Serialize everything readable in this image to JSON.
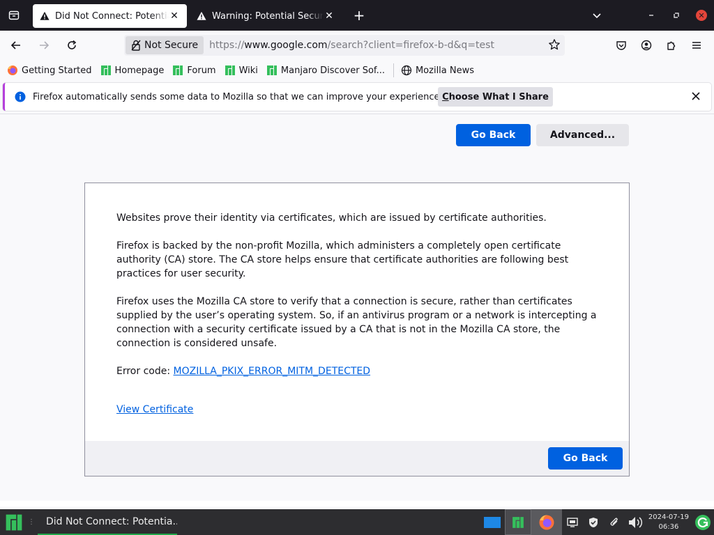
{
  "tabs": [
    {
      "title": "Did Not Connect: Potential Security Issue",
      "active": true
    },
    {
      "title": "Warning: Potential Security Risk Ahead",
      "active": false
    }
  ],
  "navbar": {
    "not_secure_label": "Not Secure",
    "url_scheme": "https://",
    "url_host": "www.google.com",
    "url_path": "/search?client=firefox-b-d&q=test"
  },
  "bookmarks": [
    {
      "label": "Getting Started",
      "icon": "firefox-icon"
    },
    {
      "label": "Homepage",
      "icon": "manjaro-icon"
    },
    {
      "label": "Forum",
      "icon": "manjaro-icon"
    },
    {
      "label": "Wiki",
      "icon": "manjaro-icon"
    },
    {
      "label": "Manjaro Discover Sof...",
      "icon": "manjaro-icon"
    },
    {
      "label": "Mozilla News",
      "icon": "globe-icon"
    }
  ],
  "notification": {
    "text": "Firefox automatically sends some data to Mozilla so that we can improve your experience.",
    "button_prefix": "C",
    "button_rest": "hoose What I Share"
  },
  "content": {
    "go_back_label": "Go Back",
    "advanced_label": "Advanced...",
    "paragraph1": "Websites prove their identity via certificates, which are issued by certificate authorities.",
    "paragraph2": "Firefox is backed by the non-profit Mozilla, which administers a completely open certificate authority (CA) store. The CA store helps ensure that certificate authorities are following best practices for user security.",
    "paragraph3": "Firefox uses the Mozilla CA store to verify that a connection is secure, rather than certificates supplied by the user’s operating system. So, if an antivirus program or a network is intercepting a connection with a security certificate issued by a CA that is not in the Mozilla CA store, the connection is considered unsafe.",
    "error_code_label": "Error code: ",
    "error_code": "MOZILLA_PKIX_ERROR_MITM_DETECTED",
    "view_certificate_label": "View Certificate",
    "footer_go_back_label": "Go Back"
  },
  "taskbar": {
    "task_title": "Did Not Connect: Potentia...",
    "clock_date": "2024-07-19",
    "clock_time": "06:36"
  },
  "colors": {
    "accent_blue": "#0061e0",
    "manjaro_green": "#35bf5c",
    "close_red": "#e3453a",
    "notification_stripe": "#b53fdb"
  }
}
